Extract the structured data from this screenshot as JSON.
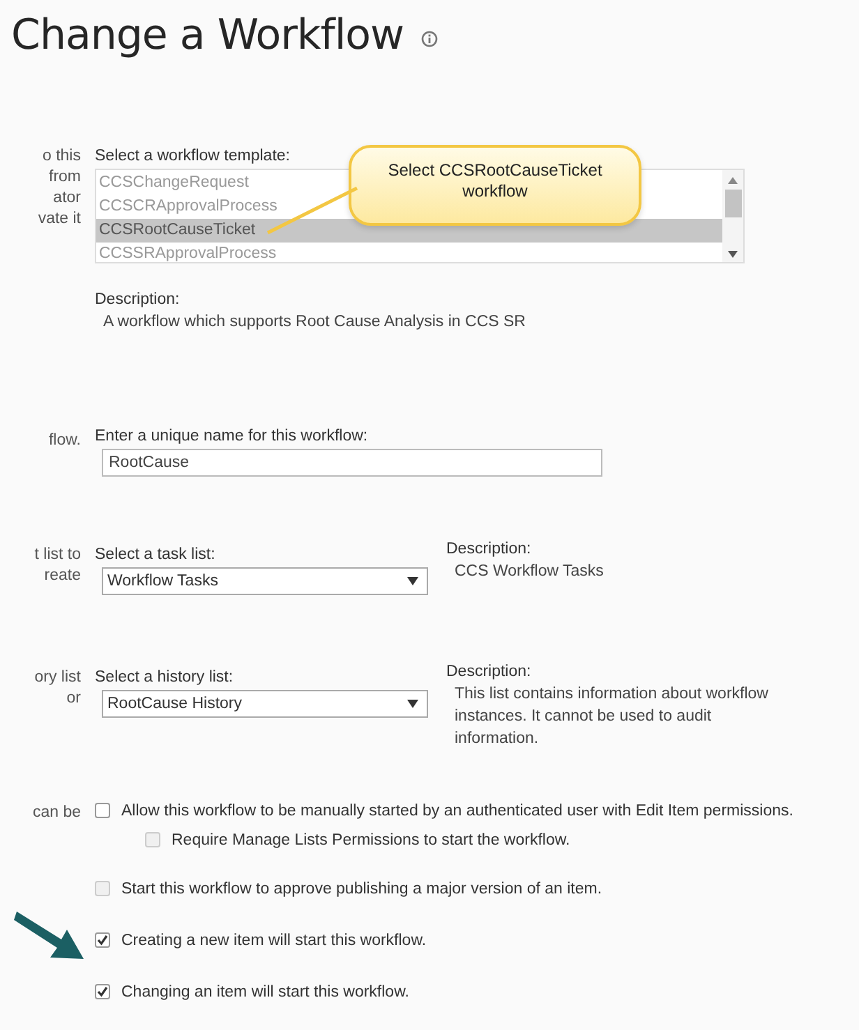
{
  "title": "Change a Workflow",
  "sections": [
    {
      "side_text": [
        "o this",
        "from",
        "ator",
        "vate it"
      ],
      "kind": "listbox",
      "label": "Select a workflow template:",
      "items": [
        {
          "label": "CCSChangeRequest",
          "selected": false
        },
        {
          "label": "CCSCRApprovalProcess",
          "selected": false
        },
        {
          "label": "CCSRootCauseTicket",
          "selected": true
        },
        {
          "label": "CCSSRApprovalProcess",
          "selected": false
        }
      ],
      "description_label": "Description:",
      "description": "A workflow which supports Root Cause Analysis in CCS SR"
    },
    {
      "side_text": [
        "flow."
      ],
      "kind": "input",
      "label": "Enter a unique name for this workflow:",
      "value": "RootCause"
    },
    {
      "side_text": [
        "t list to",
        "reate"
      ],
      "kind": "select",
      "label": "Select a task list:",
      "value": "Workflow Tasks",
      "description_label": "Description:",
      "description": "CCS Workflow Tasks"
    },
    {
      "side_text": [
        "ory list",
        "or"
      ],
      "kind": "select",
      "label": "Select a history list:",
      "value": "RootCause History",
      "description_label": "Description:",
      "description": "This list contains information about workflow instances. It cannot be used to audit information."
    },
    {
      "side_text": [
        "can be"
      ],
      "kind": "checks",
      "options": [
        {
          "label": "Allow this workflow to be manually started by an authenticated user with Edit Item permissions.",
          "checked": false,
          "disabled": false,
          "children": [
            {
              "label": "Require Manage Lists Permissions to start the workflow.",
              "checked": false,
              "disabled": true
            }
          ]
        },
        {
          "label": "Start this workflow to approve publishing a major version of an item.",
          "checked": false,
          "disabled": true
        },
        {
          "label": "Creating a new item will start this workflow.",
          "checked": true,
          "disabled": false
        },
        {
          "label": "Changing an item will start this workflow.",
          "checked": true,
          "disabled": false
        }
      ]
    }
  ],
  "callout": {
    "text": "Select CCSRootCauseTicket workflow"
  }
}
